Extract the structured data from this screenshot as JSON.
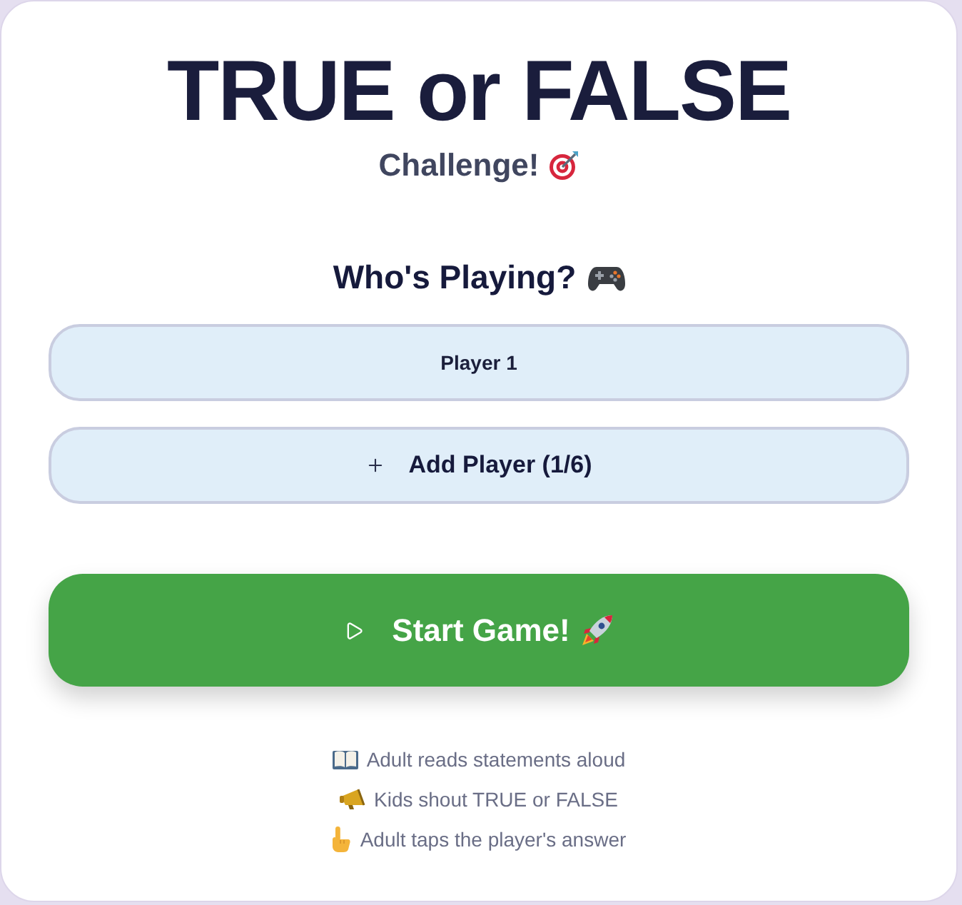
{
  "header": {
    "title": "TRUE or FALSE",
    "subtitle": "Challenge!"
  },
  "players_section": {
    "heading": "Who's Playing?",
    "players": [
      {
        "name": "Player 1"
      }
    ],
    "add_button": "Add Player (1/6)"
  },
  "start_button": "Start Game!",
  "instructions": [
    {
      "kind": "book",
      "text": "Adult reads statements aloud"
    },
    {
      "kind": "megaphone",
      "text": "Kids shout TRUE or FALSE"
    },
    {
      "kind": "pointing-hand",
      "text": "Adult taps the player's answer"
    }
  ]
}
